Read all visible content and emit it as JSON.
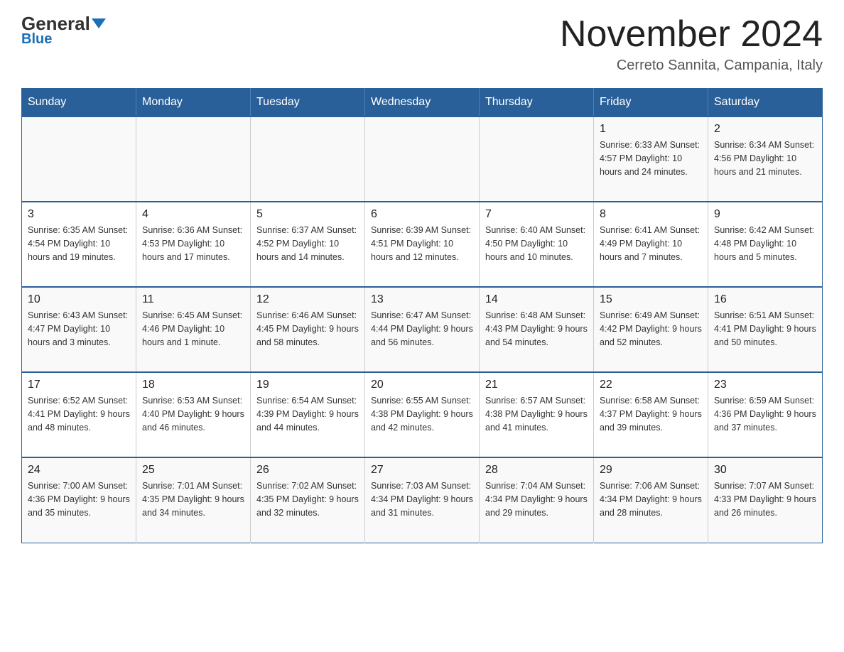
{
  "header": {
    "logo_general": "General",
    "logo_blue": "Blue",
    "month_title": "November 2024",
    "location": "Cerreto Sannita, Campania, Italy"
  },
  "weekdays": [
    "Sunday",
    "Monday",
    "Tuesday",
    "Wednesday",
    "Thursday",
    "Friday",
    "Saturday"
  ],
  "weeks": [
    [
      {
        "day": "",
        "info": ""
      },
      {
        "day": "",
        "info": ""
      },
      {
        "day": "",
        "info": ""
      },
      {
        "day": "",
        "info": ""
      },
      {
        "day": "",
        "info": ""
      },
      {
        "day": "1",
        "info": "Sunrise: 6:33 AM\nSunset: 4:57 PM\nDaylight: 10 hours and 24 minutes."
      },
      {
        "day": "2",
        "info": "Sunrise: 6:34 AM\nSunset: 4:56 PM\nDaylight: 10 hours and 21 minutes."
      }
    ],
    [
      {
        "day": "3",
        "info": "Sunrise: 6:35 AM\nSunset: 4:54 PM\nDaylight: 10 hours and 19 minutes."
      },
      {
        "day": "4",
        "info": "Sunrise: 6:36 AM\nSunset: 4:53 PM\nDaylight: 10 hours and 17 minutes."
      },
      {
        "day": "5",
        "info": "Sunrise: 6:37 AM\nSunset: 4:52 PM\nDaylight: 10 hours and 14 minutes."
      },
      {
        "day": "6",
        "info": "Sunrise: 6:39 AM\nSunset: 4:51 PM\nDaylight: 10 hours and 12 minutes."
      },
      {
        "day": "7",
        "info": "Sunrise: 6:40 AM\nSunset: 4:50 PM\nDaylight: 10 hours and 10 minutes."
      },
      {
        "day": "8",
        "info": "Sunrise: 6:41 AM\nSunset: 4:49 PM\nDaylight: 10 hours and 7 minutes."
      },
      {
        "day": "9",
        "info": "Sunrise: 6:42 AM\nSunset: 4:48 PM\nDaylight: 10 hours and 5 minutes."
      }
    ],
    [
      {
        "day": "10",
        "info": "Sunrise: 6:43 AM\nSunset: 4:47 PM\nDaylight: 10 hours and 3 minutes."
      },
      {
        "day": "11",
        "info": "Sunrise: 6:45 AM\nSunset: 4:46 PM\nDaylight: 10 hours and 1 minute."
      },
      {
        "day": "12",
        "info": "Sunrise: 6:46 AM\nSunset: 4:45 PM\nDaylight: 9 hours and 58 minutes."
      },
      {
        "day": "13",
        "info": "Sunrise: 6:47 AM\nSunset: 4:44 PM\nDaylight: 9 hours and 56 minutes."
      },
      {
        "day": "14",
        "info": "Sunrise: 6:48 AM\nSunset: 4:43 PM\nDaylight: 9 hours and 54 minutes."
      },
      {
        "day": "15",
        "info": "Sunrise: 6:49 AM\nSunset: 4:42 PM\nDaylight: 9 hours and 52 minutes."
      },
      {
        "day": "16",
        "info": "Sunrise: 6:51 AM\nSunset: 4:41 PM\nDaylight: 9 hours and 50 minutes."
      }
    ],
    [
      {
        "day": "17",
        "info": "Sunrise: 6:52 AM\nSunset: 4:41 PM\nDaylight: 9 hours and 48 minutes."
      },
      {
        "day": "18",
        "info": "Sunrise: 6:53 AM\nSunset: 4:40 PM\nDaylight: 9 hours and 46 minutes."
      },
      {
        "day": "19",
        "info": "Sunrise: 6:54 AM\nSunset: 4:39 PM\nDaylight: 9 hours and 44 minutes."
      },
      {
        "day": "20",
        "info": "Sunrise: 6:55 AM\nSunset: 4:38 PM\nDaylight: 9 hours and 42 minutes."
      },
      {
        "day": "21",
        "info": "Sunrise: 6:57 AM\nSunset: 4:38 PM\nDaylight: 9 hours and 41 minutes."
      },
      {
        "day": "22",
        "info": "Sunrise: 6:58 AM\nSunset: 4:37 PM\nDaylight: 9 hours and 39 minutes."
      },
      {
        "day": "23",
        "info": "Sunrise: 6:59 AM\nSunset: 4:36 PM\nDaylight: 9 hours and 37 minutes."
      }
    ],
    [
      {
        "day": "24",
        "info": "Sunrise: 7:00 AM\nSunset: 4:36 PM\nDaylight: 9 hours and 35 minutes."
      },
      {
        "day": "25",
        "info": "Sunrise: 7:01 AM\nSunset: 4:35 PM\nDaylight: 9 hours and 34 minutes."
      },
      {
        "day": "26",
        "info": "Sunrise: 7:02 AM\nSunset: 4:35 PM\nDaylight: 9 hours and 32 minutes."
      },
      {
        "day": "27",
        "info": "Sunrise: 7:03 AM\nSunset: 4:34 PM\nDaylight: 9 hours and 31 minutes."
      },
      {
        "day": "28",
        "info": "Sunrise: 7:04 AM\nSunset: 4:34 PM\nDaylight: 9 hours and 29 minutes."
      },
      {
        "day": "29",
        "info": "Sunrise: 7:06 AM\nSunset: 4:34 PM\nDaylight: 9 hours and 28 minutes."
      },
      {
        "day": "30",
        "info": "Sunrise: 7:07 AM\nSunset: 4:33 PM\nDaylight: 9 hours and 26 minutes."
      }
    ]
  ]
}
